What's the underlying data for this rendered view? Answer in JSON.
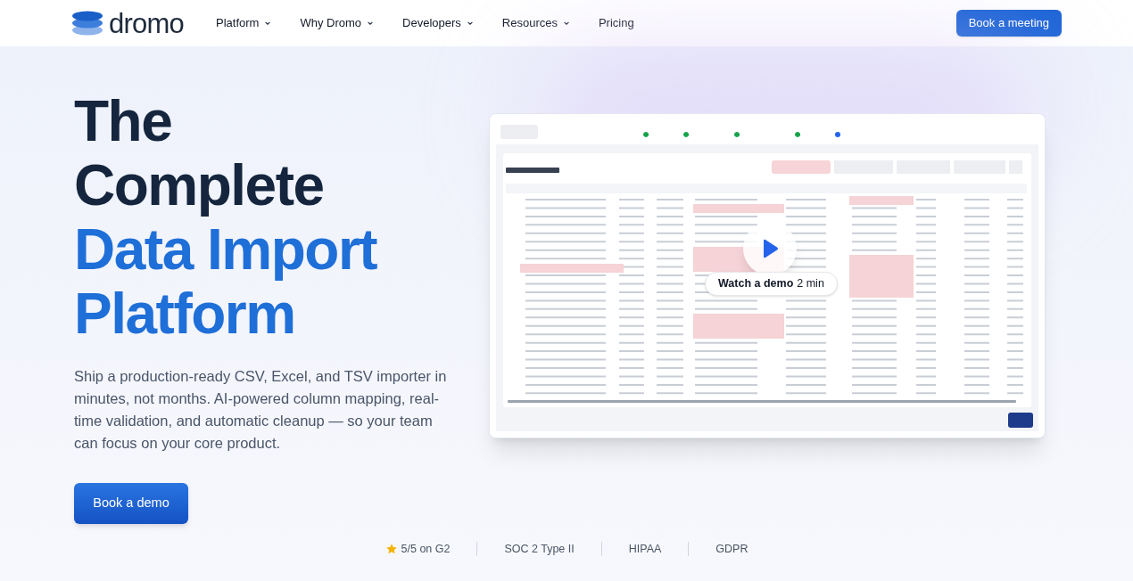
{
  "nav": {
    "logo": "dromo",
    "items": [
      {
        "label": "Platform",
        "dropdown": true
      },
      {
        "label": "Why Dromo",
        "dropdown": true
      },
      {
        "label": "Developers",
        "dropdown": true
      },
      {
        "label": "Resources",
        "dropdown": true
      },
      {
        "label": "Pricing",
        "dropdown": false
      }
    ],
    "cta": "Book a meeting"
  },
  "hero": {
    "title_lines": [
      {
        "text": "The",
        "accent": false
      },
      {
        "text": "Complete",
        "accent": false
      },
      {
        "text": "Data Import",
        "accent": true
      },
      {
        "text": "Platform",
        "accent": true
      }
    ],
    "description": "Ship a production-ready CSV, Excel, and TSV importer in minutes, not months. AI-powered column mapping, real-time validation, and automatic cleanup — so your team can focus on your core product.",
    "cta": "Book a demo"
  },
  "demo": {
    "kind": "picture",
    "video": {
      "label": "Watch a demo",
      "duration": "2 min"
    }
  },
  "trust": [
    {
      "label": "5/5 on G2",
      "star": true
    },
    {
      "label": "SOC 2 Type II",
      "star": false
    },
    {
      "label": "HIPAA",
      "star": false
    },
    {
      "label": "GDPR",
      "star": false
    }
  ]
}
